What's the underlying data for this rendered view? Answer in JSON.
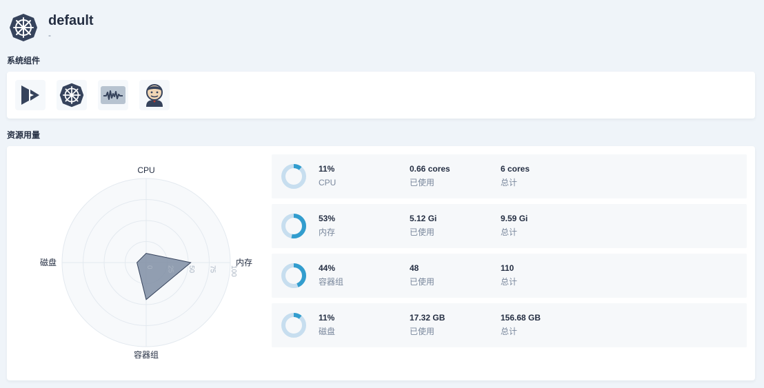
{
  "header": {
    "title": "default",
    "description": "-",
    "logo_icon": "kubernetes-helm-icon"
  },
  "sections": {
    "components": "系统组件",
    "resources": "资源用量"
  },
  "components": [
    {
      "name": "kubesphere",
      "icon": "kubesphere-icon"
    },
    {
      "name": "kubernetes",
      "icon": "kubernetes-icon"
    },
    {
      "name": "monitoring",
      "icon": "monitoring-waveform-icon"
    },
    {
      "name": "devops",
      "icon": "jenkins-icon"
    }
  ],
  "radar": {
    "axes": [
      "CPU",
      "内存",
      "容器组",
      "磁盘"
    ],
    "ticks": [
      "0",
      "25",
      "50",
      "75",
      "100"
    ],
    "values": [
      11,
      53,
      44,
      11
    ],
    "max": 100,
    "colors": {
      "fill": "#8593a9",
      "stroke": "#36435c",
      "grid": "#e3e9ef",
      "bg": "#f7f9fb"
    }
  },
  "metrics": [
    {
      "percent": "11%",
      "percent_value": 11,
      "name": "CPU",
      "used": "0.66 cores",
      "used_label": "已使用",
      "total": "6 cores",
      "total_label": "总计"
    },
    {
      "percent": "53%",
      "percent_value": 53,
      "name": "内存",
      "used": "5.12 Gi",
      "used_label": "已使用",
      "total": "9.59 Gi",
      "total_label": "总计"
    },
    {
      "percent": "44%",
      "percent_value": 44,
      "name": "容器组",
      "used": "48",
      "used_label": "已使用",
      "total": "110",
      "total_label": "总计"
    },
    {
      "percent": "11%",
      "percent_value": 11,
      "name": "磁盘",
      "used": "17.32 GB",
      "used_label": "已使用",
      "total": "156.68 GB",
      "total_label": "总计"
    }
  ],
  "colors": {
    "donut_fill": "#329dce",
    "donut_track": "#c7deef",
    "text_primary": "#242e42",
    "text_secondary": "#79879c"
  }
}
